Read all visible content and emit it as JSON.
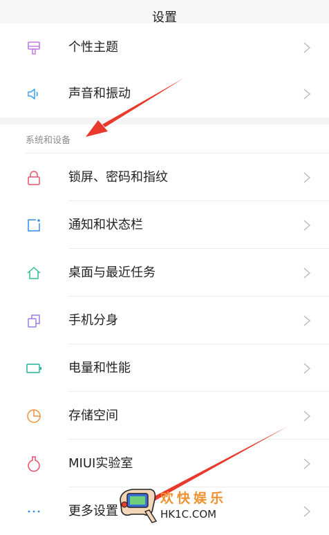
{
  "header": {
    "title": "设置"
  },
  "section_title": "系统和设备",
  "rows_top": [
    {
      "label": "个性主题",
      "icon": "theme-brush-icon"
    },
    {
      "label": "声音和振动",
      "icon": "speaker-icon"
    }
  ],
  "rows": [
    {
      "label": "锁屏、密码和指纹",
      "icon": "lock-icon"
    },
    {
      "label": "通知和状态栏",
      "icon": "notification-icon"
    },
    {
      "label": "桌面与最近任务",
      "icon": "home-icon"
    },
    {
      "label": "手机分身",
      "icon": "dual-copy-icon"
    },
    {
      "label": "电量和性能",
      "icon": "battery-icon"
    },
    {
      "label": "存储空间",
      "icon": "storage-pie-icon"
    },
    {
      "label": "MIUI实验室",
      "icon": "flask-icon"
    },
    {
      "label": "更多设置",
      "icon": "more-dots-icon"
    }
  ],
  "watermark": {
    "line1": "欢快娱乐",
    "line2": "HK1C.COM"
  },
  "colors": {
    "theme_icon": "#c07ae0",
    "sound_icon": "#3aa0f0",
    "lock_icon": "#e8506a",
    "notify_icon": "#2f8ee8",
    "home_icon": "#2bbd9a",
    "dual_icon": "#9b7ae0",
    "battery_icon": "#22b59a",
    "storage_icon": "#f0903a",
    "flask_icon": "#e8506a",
    "more_icon": "#2f8ee8",
    "annotation_arrow": "#e8392c"
  }
}
